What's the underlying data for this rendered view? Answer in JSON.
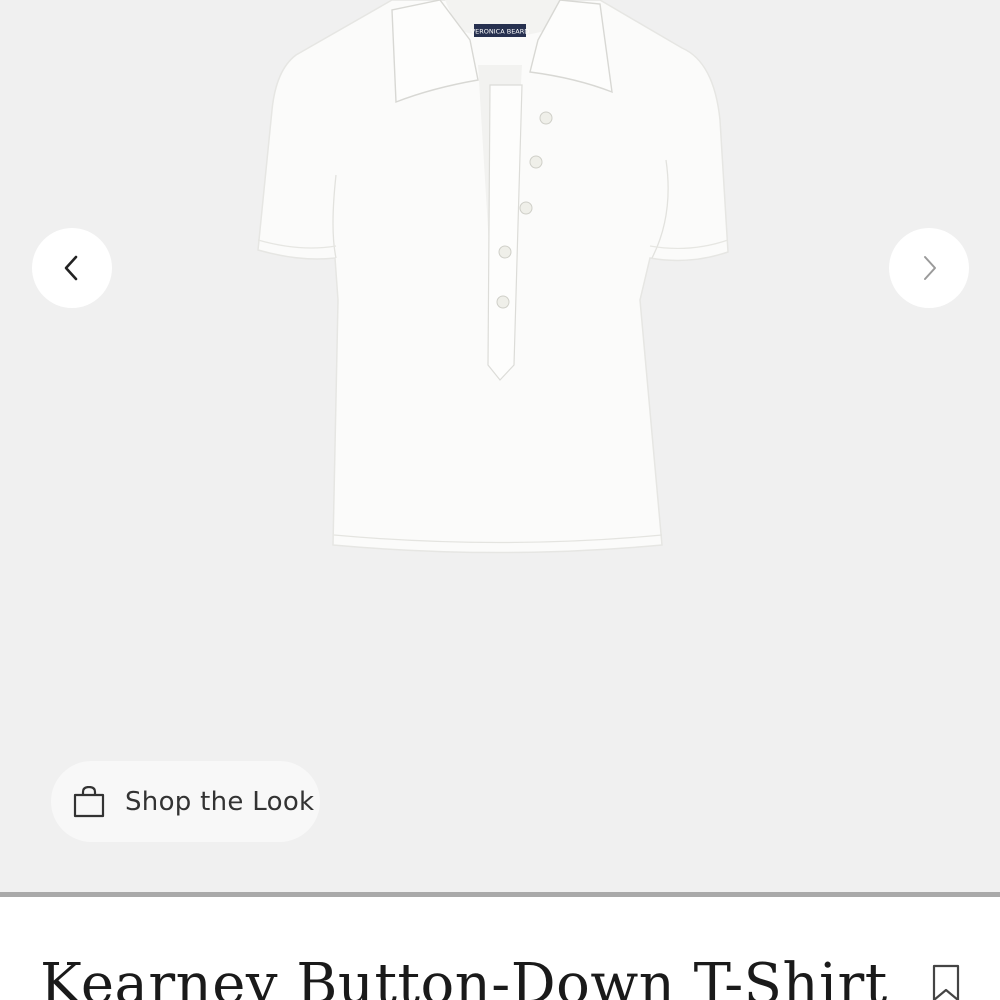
{
  "gallery": {
    "prev_icon": "chevron-left-icon",
    "next_icon": "chevron-right-icon",
    "image_subject": "white short-sleeve button-down polo t-shirt",
    "background_color": "#f0f0f0"
  },
  "shop_the_look": {
    "label": "Shop the Look",
    "icon": "shopping-bag-icon"
  },
  "product": {
    "title": "Kearney Button-Down T-Shirt",
    "save_icon": "bookmark-icon"
  }
}
